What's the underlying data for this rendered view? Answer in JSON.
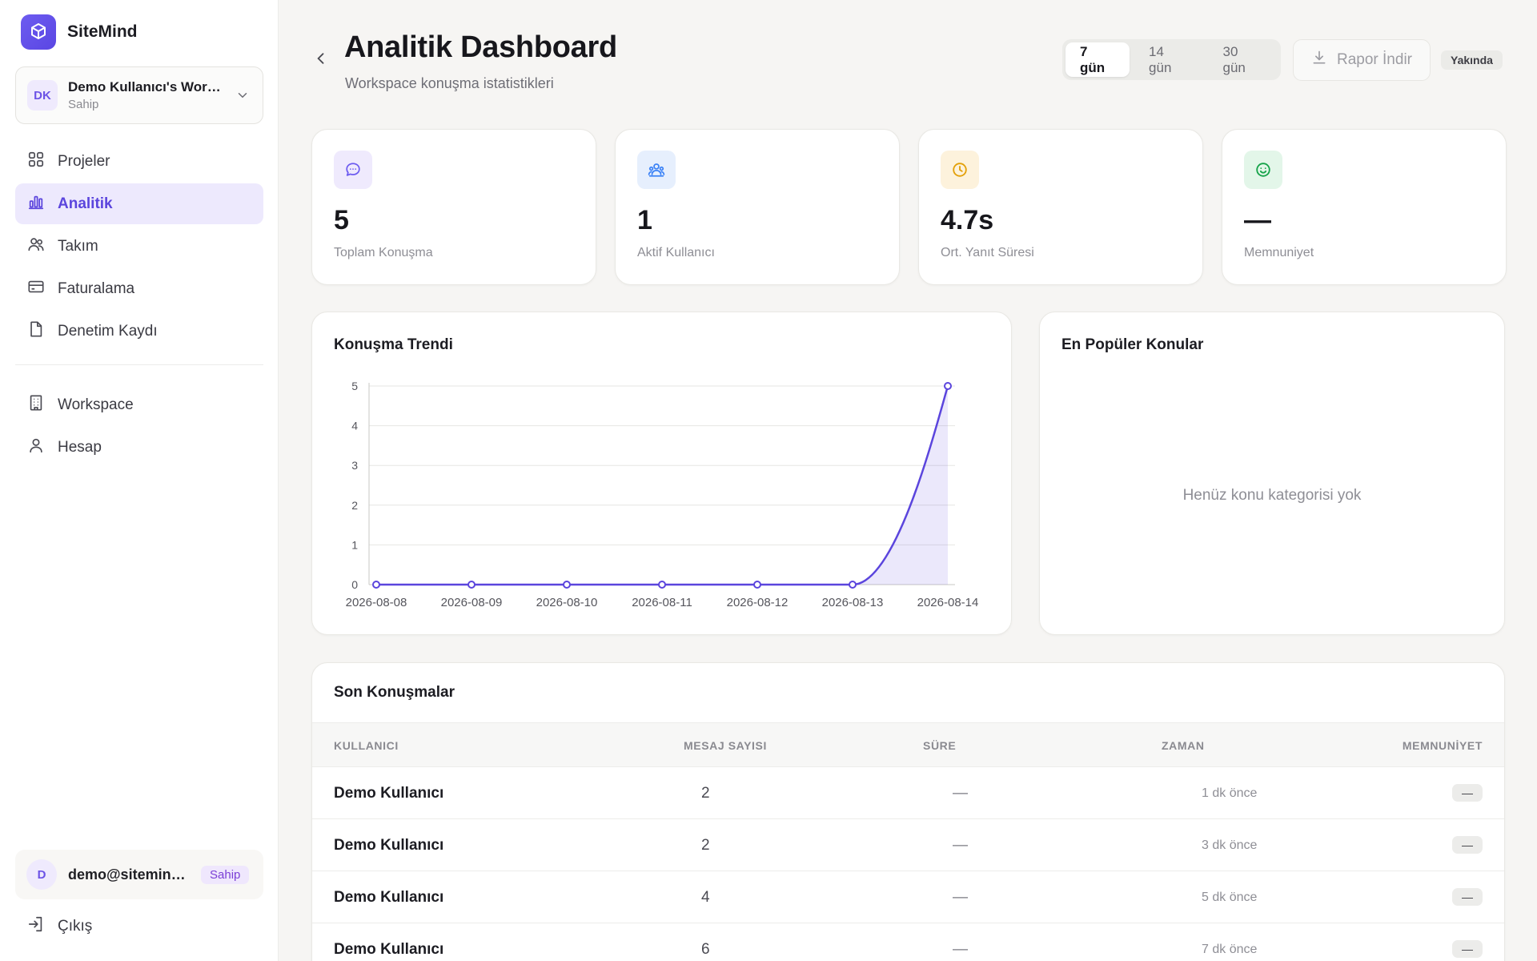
{
  "brand": {
    "name": "SiteMind"
  },
  "workspace": {
    "initials": "DK",
    "name": "Demo Kullanıcı's Workspace",
    "role": "Sahip"
  },
  "nav": {
    "items": [
      {
        "label": "Projeler",
        "icon": "grid-icon"
      },
      {
        "label": "Analitik",
        "icon": "bar-chart-icon",
        "active": true
      },
      {
        "label": "Takım",
        "icon": "users-icon"
      },
      {
        "label": "Faturalama",
        "icon": "credit-card-icon"
      },
      {
        "label": "Denetim Kaydı",
        "icon": "file-icon"
      }
    ],
    "secondary": [
      {
        "label": "Workspace",
        "icon": "building-icon"
      },
      {
        "label": "Hesap",
        "icon": "user-icon"
      }
    ]
  },
  "user": {
    "initial": "D",
    "email": "demo@sitemind.com",
    "badge": "Sahip"
  },
  "logout_label": "Çıkış",
  "header": {
    "title": "Analitik Dashboard",
    "subtitle": "Workspace konuşma istatistikleri",
    "ranges": [
      "7 gün",
      "14 gün",
      "30 gün"
    ],
    "active_range": "7 gün",
    "report_label": "Rapor İndir",
    "soon_label": "Yakında"
  },
  "stats": [
    {
      "value": "5",
      "label": "Toplam Konuşma",
      "icon": "message-icon",
      "color": "#6d5cf0",
      "bg": "#efeafd"
    },
    {
      "value": "1",
      "label": "Aktif Kullanıcı",
      "icon": "users-icon",
      "color": "#3b82f6",
      "bg": "#e6effd"
    },
    {
      "value": "4.7s",
      "label": "Ort. Yanıt Süresi",
      "icon": "clock-icon",
      "color": "#e3a008",
      "bg": "#fdf2dc"
    },
    {
      "value": "—",
      "label": "Memnuniyet",
      "icon": "smile-icon",
      "color": "#16a34a",
      "bg": "#e3f6e9"
    }
  ],
  "trend": {
    "title": "Konuşma Trendi"
  },
  "chart_data": {
    "type": "line",
    "x": [
      "2026-08-08",
      "2026-08-09",
      "2026-08-10",
      "2026-08-11",
      "2026-08-12",
      "2026-08-13",
      "2026-08-14"
    ],
    "series": [
      {
        "values": [
          0,
          0,
          0,
          0,
          0,
          0,
          5
        ],
        "color": "#5b45dd"
      }
    ],
    "ylim": [
      0,
      5
    ],
    "yticks": [
      0,
      1,
      2,
      3,
      4,
      5
    ],
    "grid": true,
    "fill": true
  },
  "topics": {
    "title": "En Popüler Konular",
    "empty": "Henüz konu kategorisi yok"
  },
  "recent": {
    "title": "Son Konuşmalar",
    "columns": [
      "KULLANICI",
      "MESAJ SAYISI",
      "SÜRE",
      "ZAMAN",
      "MEMNUNİYET"
    ],
    "rows": [
      {
        "user": "Demo Kullanıcı",
        "count": "2",
        "duration": "—",
        "time": "1 dk önce",
        "sat": "—"
      },
      {
        "user": "Demo Kullanıcı",
        "count": "2",
        "duration": "—",
        "time": "3 dk önce",
        "sat": "—"
      },
      {
        "user": "Demo Kullanıcı",
        "count": "4",
        "duration": "—",
        "time": "5 dk önce",
        "sat": "—"
      },
      {
        "user": "Demo Kullanıcı",
        "count": "6",
        "duration": "—",
        "time": "7 dk önce",
        "sat": "—"
      }
    ]
  }
}
